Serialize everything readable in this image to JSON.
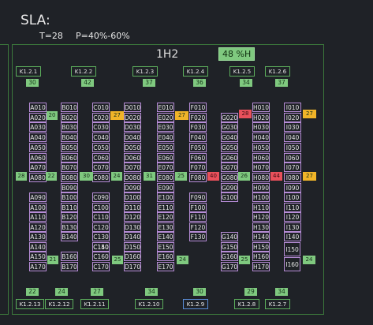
{
  "sla": {
    "title": "SLA:",
    "temperature": "T=28",
    "pressure": "P=40%-60%"
  },
  "room": {
    "name": "1H2",
    "humidity": "48 %H"
  },
  "colors": {
    "normal": "#7fc97f",
    "warning": "#f0b428",
    "critical": "#e8505b"
  },
  "top_units": [
    {
      "label": "K1.2.1",
      "value": "30"
    },
    {
      "label": "K1.2.2",
      "value": "42"
    },
    {
      "label": "K1.2.3",
      "value": "37"
    },
    {
      "label": "K1.2.4",
      "value": "36"
    },
    {
      "label": "K1.2.5",
      "value": "34"
    },
    {
      "label": "K1.2.6",
      "value": "37"
    }
  ],
  "bottom_units": [
    {
      "label": "K1.2.13",
      "value": "22"
    },
    {
      "label": "K1.2.12",
      "value": "24"
    },
    {
      "label": "K1.2.11",
      "value": "27"
    },
    {
      "label": "K1.2.10",
      "value": "34"
    },
    {
      "label": "K1.2.9",
      "value": "30"
    },
    {
      "label": "K1.2.8",
      "value": "29"
    },
    {
      "label": "K1.2.7",
      "value": "34"
    }
  ],
  "columns": [
    {
      "id": "A",
      "racks": [
        "A010",
        "A020",
        "A030",
        "A040",
        "A050",
        "A060",
        "A070",
        "A080",
        "",
        "A090",
        "A100",
        "A110",
        "A120",
        "A130",
        "A140",
        "A150",
        "A170"
      ]
    },
    {
      "id": "B",
      "racks": [
        "B010",
        "B020",
        "B030",
        "B040",
        "B050",
        "B060",
        "B070",
        "B080",
        "B090",
        "B100",
        "B110",
        "B120",
        "B130",
        "B140",
        "B160",
        "B170"
      ]
    },
    {
      "id": "C",
      "racks": [
        "C010",
        "C020",
        "C030",
        "C040",
        "C050",
        "C060",
        "C070",
        "C080",
        "",
        "C090",
        "C100",
        "C110",
        "C120",
        "C130",
        "C140",
        "C150",
        "C160",
        "C170"
      ]
    },
    {
      "id": "D",
      "racks": [
        "D010",
        "D020",
        "D030",
        "D040",
        "D050",
        "D060",
        "D070",
        "D080",
        "D090",
        "D100",
        "D110",
        "D120",
        "D130",
        "D140",
        "D150",
        "D160",
        "D170"
      ]
    },
    {
      "id": "E",
      "racks": [
        "E010",
        "E020",
        "E030",
        "E040",
        "E050",
        "E060",
        "E070",
        "E080",
        "E090",
        "E100",
        "E110",
        "E120",
        "E130",
        "E140",
        "E150",
        "E160",
        "E170"
      ]
    },
    {
      "id": "F",
      "racks": [
        "F010",
        "F020",
        "F030",
        "F040",
        "F050",
        "F060",
        "F070",
        "F080",
        "F090",
        "F100",
        "F110",
        "F120",
        "F130"
      ]
    },
    {
      "id": "G",
      "racks": [
        "G020",
        "G030",
        "G040",
        "G050",
        "G060",
        "G070",
        "G080",
        "G090",
        "G100",
        "G140",
        "G150",
        "G160",
        "G170"
      ]
    },
    {
      "id": "H",
      "racks": [
        "H010",
        "H020",
        "H030",
        "H040",
        "H050",
        "H060",
        "H070",
        "H080",
        "H090",
        "H100",
        "H110",
        "H120",
        "H130",
        "H140",
        "H150",
        "H160",
        "H170"
      ]
    },
    {
      "id": "I",
      "racks": [
        "I010",
        "I020",
        "I030",
        "I040",
        "I050",
        "I060",
        "I070",
        "I080",
        "I090",
        "I100",
        "I110",
        "I120",
        "I130",
        "I140",
        "I150",
        "I160"
      ]
    }
  ],
  "sensors": [
    {
      "value": "20",
      "status": "normal"
    },
    {
      "value": "27",
      "status": "warning"
    },
    {
      "value": "27",
      "status": "warning"
    },
    {
      "value": "28",
      "status": "critical"
    },
    {
      "value": "27",
      "status": "warning"
    },
    {
      "value": "28",
      "status": "normal"
    },
    {
      "value": "22",
      "status": "normal"
    },
    {
      "value": "30",
      "status": "normal"
    },
    {
      "value": "24",
      "status": "normal"
    },
    {
      "value": "31",
      "status": "normal"
    },
    {
      "value": "25",
      "status": "normal"
    },
    {
      "value": "40",
      "status": "critical"
    },
    {
      "value": "26",
      "status": "normal"
    },
    {
      "value": "44",
      "status": "critical"
    },
    {
      "value": "27",
      "status": "warning"
    },
    {
      "value": "21",
      "status": "normal"
    },
    {
      "value": "25",
      "status": "normal"
    },
    {
      "value": "24",
      "status": "normal"
    },
    {
      "value": "25",
      "status": "normal"
    },
    {
      "value": "24",
      "status": "normal"
    }
  ]
}
